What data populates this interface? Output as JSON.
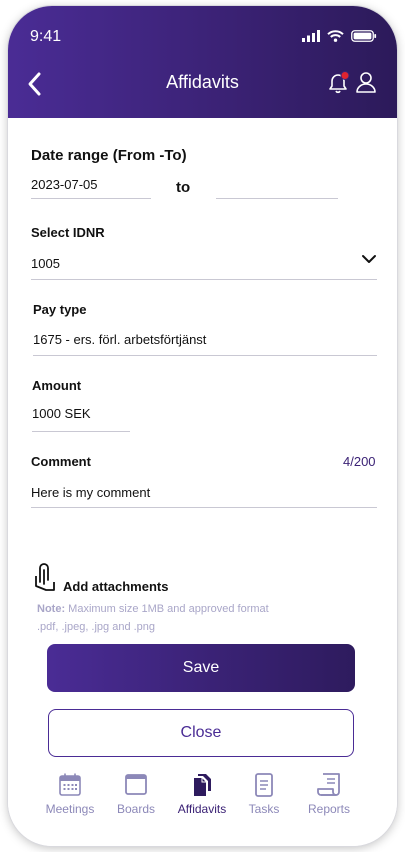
{
  "status": {
    "time": "9:41"
  },
  "header": {
    "title": "Affidavits"
  },
  "form": {
    "date_range": {
      "label": "Date range (From -To)",
      "from": "2023-07-05",
      "separator": "to",
      "to": ""
    },
    "idnr": {
      "label": "Select IDNR",
      "value": "1005"
    },
    "pay_type": {
      "label": "Pay type",
      "value": "1675 - ers. förl. arbetsförtjänst"
    },
    "amount": {
      "label": "Amount",
      "value": "1000 SEK"
    },
    "comment": {
      "label": "Comment",
      "counter": "4/200",
      "value": "Here is my comment"
    }
  },
  "attachments": {
    "label": "Add attachments",
    "note_prefix": "Note:",
    "note_text": " Maximum size 1MB and approved format",
    "note_line2": ".pdf, .jpeg, .jpg and .png"
  },
  "buttons": {
    "save": "Save",
    "close": "Close"
  },
  "tabs": [
    {
      "label": "Meetings",
      "icon": "calendar-icon",
      "active": false
    },
    {
      "label": "Boards",
      "icon": "window-icon",
      "active": false
    },
    {
      "label": "Affidavits",
      "icon": "documents-icon",
      "active": true
    },
    {
      "label": "Tasks",
      "icon": "document-icon",
      "active": false
    },
    {
      "label": "Reports",
      "icon": "report-icon",
      "active": false
    }
  ],
  "colors": {
    "primary": "#3b2275",
    "inactive_tab": "#8c88b8",
    "note": "#a9a6c8",
    "accent_red": "#e0242f"
  }
}
